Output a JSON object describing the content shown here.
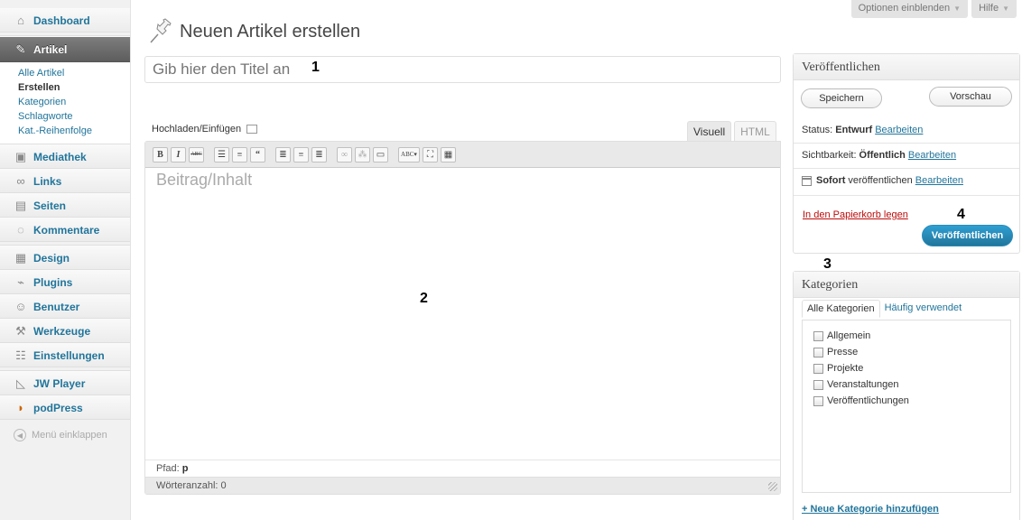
{
  "sidebar": {
    "dashboard": "Dashboard",
    "articles": "Artikel",
    "articles_submenu": [
      "Alle Artikel",
      "Erstellen",
      "Kategorien",
      "Schlagworte",
      "Kat.-Reihenfolge"
    ],
    "media": "Mediathek",
    "links": "Links",
    "pages": "Seiten",
    "comments": "Kommentare",
    "design": "Design",
    "plugins": "Plugins",
    "users": "Benutzer",
    "tools": "Werkzeuge",
    "settings": "Einstellungen",
    "jwplayer": "JW Player",
    "podpress": "podPress",
    "collapse": "Menü einklappen"
  },
  "header": {
    "screen_options": "Optionen einblenden",
    "help": "Hilfe",
    "page_title": "Neuen Artikel erstellen"
  },
  "annotations": {
    "a1": "1",
    "a2": "2",
    "a3": "3",
    "a4": "4"
  },
  "post": {
    "title_placeholder": "Gib hier den Titel an",
    "media_label": "Hochladen/Einfügen",
    "tab_visual": "Visuell",
    "tab_html": "HTML",
    "content_placeholder": "Beitrag/Inhalt",
    "path_label": "Pfad:",
    "path_value": "p",
    "word_count": "Wörteranzahl: 0"
  },
  "toolbar_buttons": [
    "bold",
    "italic",
    "strikethrough",
    "bullet-list",
    "numbered-list",
    "blockquote",
    "align-left",
    "align-center",
    "align-right",
    "link",
    "unlink",
    "more",
    "spellcheck",
    "fullscreen",
    "kitchen-sink"
  ],
  "publish": {
    "title": "Veröffentlichen",
    "save_draft": "Speichern",
    "preview": "Vorschau",
    "status_label": "Status:",
    "status_value": "Entwurf",
    "visibility_label": "Sichtbarkeit:",
    "visibility_value": "Öffentlich",
    "schedule_value": "Sofort",
    "schedule_suffix": "veröffentlichen",
    "edit": "Bearbeiten",
    "trash": "In den Papierkorb legen",
    "publish_button": "Veröffentlichen"
  },
  "categories": {
    "title": "Kategorien",
    "tab_all": "Alle Kategorien",
    "tab_popular": "Häufig verwendet",
    "items": [
      "Allgemein",
      "Presse",
      "Projekte",
      "Veranstaltungen",
      "Veröffentlichungen"
    ],
    "add_new": "+ Neue Kategorie hinzufügen"
  },
  "colors": {
    "link": "#21759b",
    "primary_button": "#21759b",
    "trash": "#bc0b0b"
  }
}
